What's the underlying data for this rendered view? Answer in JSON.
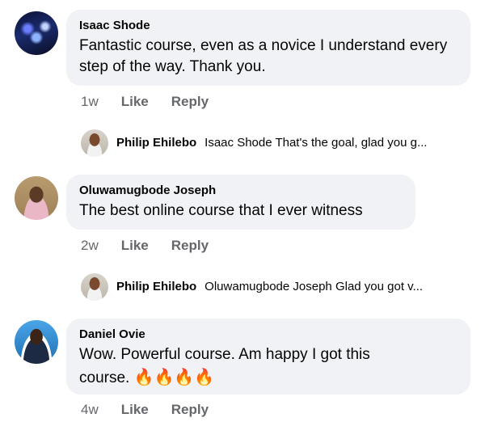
{
  "comments": [
    {
      "author": "Isaac Shode",
      "text": "Fantastic course, even as a novice I understand every step of the way. Thank you.",
      "time": "1w",
      "like_label": "Like",
      "reply_label": "Reply",
      "reply": {
        "author": "Philip Ehilebo",
        "text": "Isaac Shode That's the goal, glad you g..."
      }
    },
    {
      "author": "Oluwamugbode Joseph",
      "text": "The best  online course that I ever witness",
      "time": "2w",
      "like_label": "Like",
      "reply_label": "Reply",
      "reply": {
        "author": "Philip Ehilebo",
        "text": "Oluwamugbode Joseph Glad you got v..."
      }
    },
    {
      "author": "Daniel Ovie",
      "text_line1": "Wow. Powerful course. Am happy I got this",
      "text_line2": "course. ",
      "emoji": "🔥🔥🔥🔥",
      "time": "4w",
      "like_label": "Like",
      "reply_label": "Reply"
    }
  ]
}
